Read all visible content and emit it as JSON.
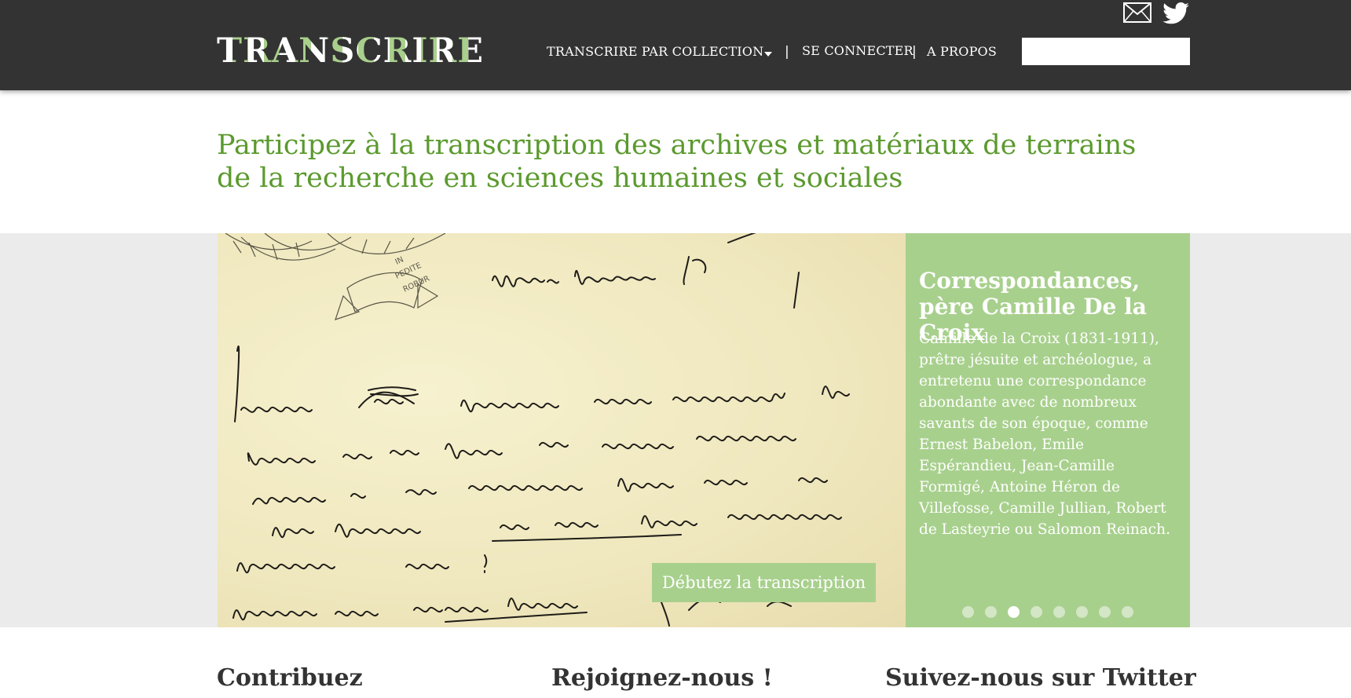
{
  "header": {
    "logo": "TRANSCRIRE",
    "nav": {
      "collection": "TRANSCRIRE PAR COLLECTION",
      "separator": "|",
      "login": "SE CONNECTER",
      "about": "A PROPOS"
    },
    "search": {
      "value": "",
      "placeholder": ""
    },
    "icons": [
      "mail-icon",
      "twitter-icon",
      "chevron-down-icon"
    ]
  },
  "headline": {
    "line1": "Participez à la transcription des archives et matériaux de terrains",
    "line2": "de la recherche en sciences humaines et sociales"
  },
  "carousel": {
    "title": "Correspondances, père Camille De la Croix",
    "description": "Camille de la Croix (1831-1911), prêtre jésuite et archéologue, a entretenu une correspondance abondante avec de nombreux savants de son époque, comme Ernest Babelon, Emile Espérandieu, Jean-Camille Formigé, Antoine Héron de Villefosse, Camille Jullian, Robert de Lasteyrie ou Salomon Reinach.",
    "cta": "Débutez la transcription",
    "dot_count": 8,
    "active_dot": 3,
    "image_subject": "handwritten-letter-manuscript",
    "colors": {
      "panel": "#a8d08d",
      "headline": "#5b9a2e",
      "header": "#333333"
    }
  },
  "sections": {
    "contribute": "Contribuez",
    "join": "Rejoignez-nous !",
    "twitter": "Suivez-nous sur Twitter"
  }
}
